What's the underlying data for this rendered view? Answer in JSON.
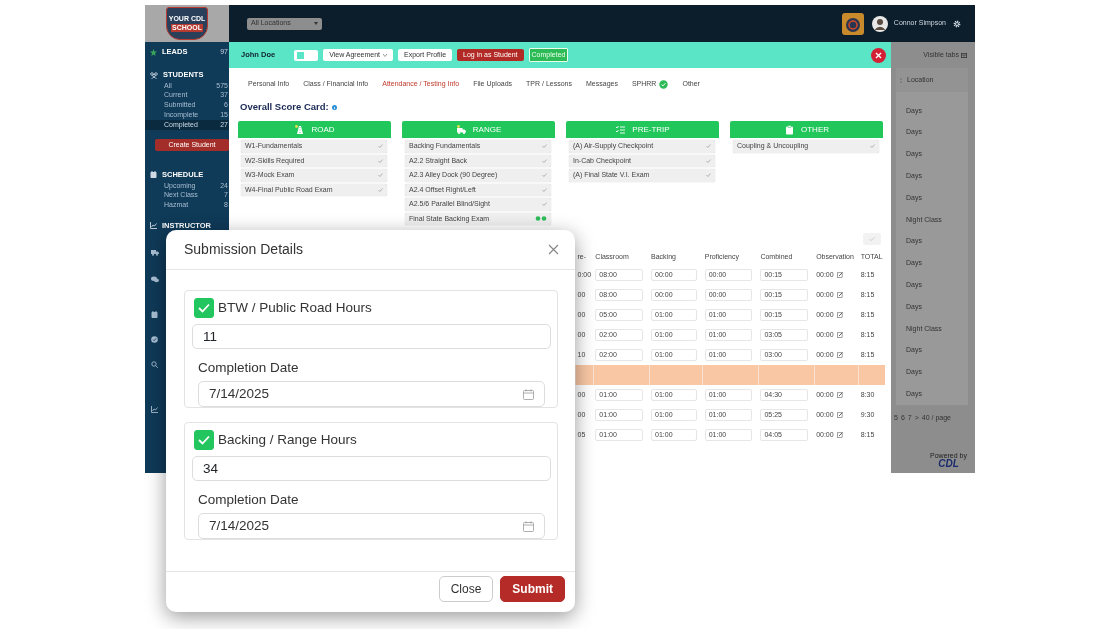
{
  "sidebar": {
    "logo_text": [
      "YOUR CDL",
      "SCHOOL"
    ],
    "sections": [
      {
        "title": "LEADS",
        "count": "97"
      },
      {
        "title": "STUDENTS",
        "items": [
          {
            "label": "All",
            "count": "575",
            "selected": false
          },
          {
            "label": "Current",
            "count": "37",
            "selected": false
          },
          {
            "label": "Submitted",
            "count": "6",
            "selected": false
          },
          {
            "label": "Incomplete",
            "count": "15",
            "selected": false
          },
          {
            "label": "Completed",
            "count": "27",
            "selected": true
          }
        ],
        "button": "Create Student"
      },
      {
        "title": "SCHEDULE",
        "items": [
          {
            "label": "Upcoming",
            "count": "24",
            "selected": false
          },
          {
            "label": "Next Class",
            "count": "7",
            "selected": false
          },
          {
            "label": "Hazmat",
            "count": "8",
            "selected": false
          }
        ]
      },
      {
        "title": "INSTRUCTOR"
      }
    ]
  },
  "topbar": {
    "location_select": "All Locations",
    "user_name": "Connor Simpson"
  },
  "student": {
    "name": "John Doe",
    "buttons": [
      {
        "label": "View Agreement",
        "kind": "dropdown"
      },
      {
        "label": "Export Profile",
        "kind": "plain"
      },
      {
        "label": "Log in as Student",
        "kind": "danger"
      }
    ],
    "status_badge": "Completed",
    "tabs": [
      {
        "label": "Personal Info",
        "selected": false
      },
      {
        "label": "Class / Financial Info",
        "selected": false
      },
      {
        "label": "Attendance / Testing Info",
        "selected": true
      },
      {
        "label": "File Uploads",
        "selected": false
      },
      {
        "label": "TPR / Lessons",
        "selected": false
      },
      {
        "label": "Messages",
        "selected": false
      },
      {
        "label": "SPHRR",
        "selected": false,
        "verified": true
      },
      {
        "label": "Other",
        "selected": false
      }
    ]
  },
  "scorecard": {
    "title": "Overall Score Card:",
    "categories": [
      {
        "title": "ROAD",
        "items": [
          {
            "label": "W1-Fundamentals",
            "completed": true
          },
          {
            "label": "W2-Skills Required",
            "completed": true
          },
          {
            "label": "W3-Mock Exam",
            "completed": true
          },
          {
            "label": "W4-Final Public Road Exam",
            "completed": true
          }
        ]
      },
      {
        "title": "RANGE",
        "items": [
          {
            "label": "Backing Fundamentals",
            "completed": true
          },
          {
            "label": "A2.2 Straight Back",
            "completed": true
          },
          {
            "label": "A2.3 Alley Dock (90 Degree)",
            "completed": true
          },
          {
            "label": "A2.4 Offset Right/Left",
            "completed": true
          },
          {
            "label": "A2.5/6 Parallel Blind/Sight",
            "completed": true
          },
          {
            "label": "Final State Backing Exam",
            "completed": false
          }
        ]
      },
      {
        "title": "PRE-TRIP",
        "items": [
          {
            "label": "(A) Air-Supply Checkpoint",
            "completed": true
          },
          {
            "label": "In-Cab Checkpoint",
            "completed": true
          },
          {
            "label": "(A) Final State V.I. Exam",
            "completed": true
          }
        ]
      },
      {
        "title": "OTHER",
        "items": [
          {
            "label": "Coupling & Uncoupling",
            "completed": true
          }
        ]
      }
    ]
  },
  "hours_table": {
    "columns": [
      "re-",
      "Classroom",
      "Backing",
      "Proficiency",
      "Combined",
      "Observation",
      "TOTAL"
    ],
    "rows": [
      {
        "kind": "entry",
        "cells": [
          "0:00",
          "08:00",
          "00:00",
          "00:00",
          "00:15",
          "00:00",
          "8:15"
        ]
      },
      {
        "kind": "entry",
        "cells": [
          "00",
          "08:00",
          "00:00",
          "00:00",
          "00:15",
          "00:00",
          "8:15"
        ]
      },
      {
        "kind": "entry",
        "cells": [
          "00",
          "05:00",
          "01:00",
          "01:00",
          "00:15",
          "00:00",
          "8:15"
        ]
      },
      {
        "kind": "entry",
        "cells": [
          "00",
          "02:00",
          "01:00",
          "01:00",
          "03:05",
          "00:00",
          "8:15"
        ]
      },
      {
        "kind": "entry",
        "cells": [
          "10",
          "02:00",
          "01:00",
          "01:00",
          "03:00",
          "00:00",
          "8:15"
        ]
      },
      {
        "kind": "highlight"
      },
      {
        "kind": "entry",
        "cells": [
          "00",
          "01:00",
          "01:00",
          "01:00",
          "04:30",
          "00:00",
          "8:30"
        ]
      },
      {
        "kind": "entry",
        "cells": [
          "00",
          "01:00",
          "01:00",
          "01:00",
          "05:25",
          "00:00",
          "9:30"
        ]
      },
      {
        "kind": "entry",
        "cells": [
          "05",
          "01:00",
          "01:00",
          "01:00",
          "04:05",
          "00:00",
          "8:15"
        ]
      }
    ]
  },
  "right_panel": {
    "visible_tabs": "Visible tabs",
    "column": "Location",
    "rows": [
      "Days",
      "Days",
      "Days",
      "Days",
      "Days",
      "Night Class",
      "Days",
      "Days",
      "Days",
      "Days",
      "Night Class",
      "Days",
      "Days",
      "Days"
    ],
    "pages": [
      "5",
      "6",
      "7",
      ">"
    ],
    "page_size": "40 / page",
    "powered_by": "Powered by",
    "brand": "CDL"
  },
  "modal": {
    "title": "Submission Details",
    "sections": [
      {
        "label": "BTW / Public Road Hours",
        "checked": true,
        "value": "11",
        "date_label": "Completion Date",
        "date": "7/14/2025"
      },
      {
        "label": "Backing / Range Hours",
        "checked": true,
        "value": "34",
        "date_label": "Completion Date",
        "date": "7/14/2025"
      }
    ],
    "buttons": [
      {
        "label": "Close",
        "kind": "secondary"
      },
      {
        "label": "Submit",
        "kind": "primary"
      }
    ]
  }
}
